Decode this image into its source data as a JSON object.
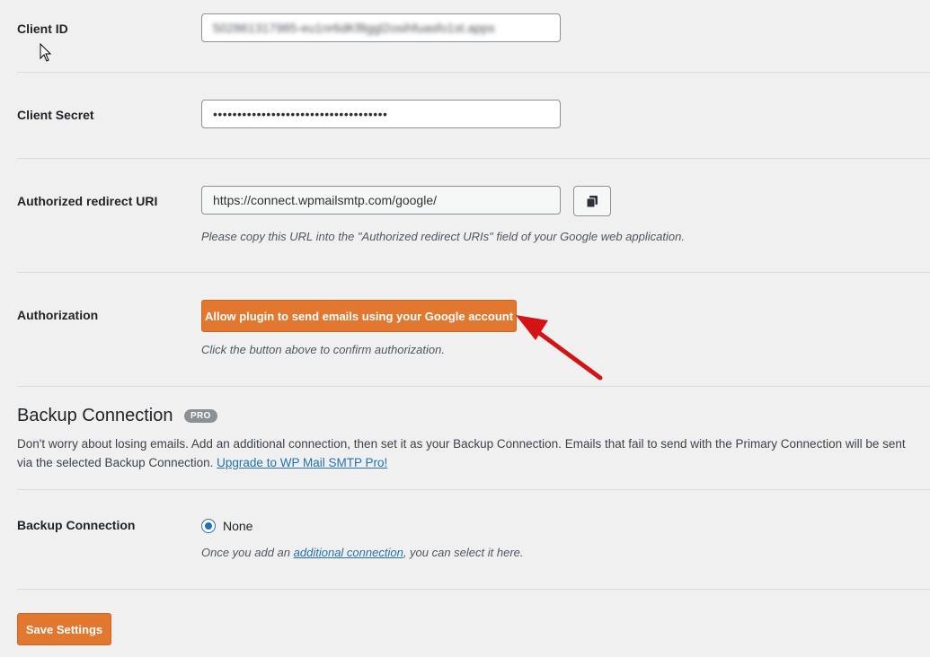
{
  "client_id": {
    "label": "Client ID",
    "value": "502861317985-eu1nr6dKf8ggl2osihfuasfo1st.apps"
  },
  "client_secret": {
    "label": "Client Secret",
    "value": "••••••••••••••••••••••••••••••••••••"
  },
  "redirect_uri": {
    "label": "Authorized redirect URI",
    "value": "https://connect.wpmailsmtp.com/google/",
    "description": "Please copy this URL into the \"Authorized redirect URIs\" field of your Google web application.",
    "copy_icon": "copy-icon"
  },
  "authorization": {
    "label": "Authorization",
    "button_label": "Allow plugin to send emails using your Google account",
    "description": "Click the button above to confirm authorization."
  },
  "backup_section": {
    "title": "Backup Connection",
    "badge": "PRO",
    "description": "Don't worry about losing emails. Add an additional connection, then set it as your Backup Connection. Emails that fail to send with the Primary Connection will be sent via the selected Backup Connection.",
    "upgrade_link": "Upgrade to WP Mail SMTP Pro!"
  },
  "backup_connection": {
    "label": "Backup Connection",
    "option_label": "None",
    "desc_prefix": "Once you add an",
    "desc_link": "additional connection",
    "desc_suffix": ", you can select it here."
  },
  "save_button": "Save Settings",
  "colors": {
    "accent_orange": "#e27730",
    "link_blue": "#2271b1",
    "annotation_red": "#d41414"
  }
}
